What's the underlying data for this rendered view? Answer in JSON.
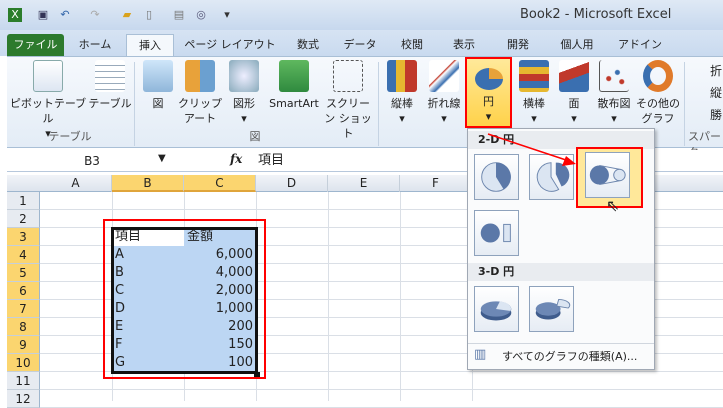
{
  "window": {
    "title": "Book2 - Microsoft Excel"
  },
  "quick_access": [
    "excel-icon",
    "save-icon",
    "undo-icon",
    "redo-icon",
    "open-icon",
    "new-icon",
    "print-preview-icon",
    "zoom-icon",
    "customize-icon"
  ],
  "tabs": [
    "ファイル",
    "ホーム",
    "挿入",
    "ページ レイアウト",
    "数式",
    "データ",
    "校閲",
    "表示",
    "開発",
    "個人用",
    "アドイン"
  ],
  "ribbon": {
    "groups": [
      "テーブル",
      "図",
      "スパーク"
    ],
    "buttons": [
      "ピボットテーブル",
      "テーブル",
      "図",
      "クリップ アート",
      "図形",
      "SmartArt",
      "スクリーン ショット",
      "縦棒",
      "折れ線",
      "円",
      "横棒",
      "面",
      "散布図",
      "その他の グラフ"
    ],
    "sparklines": [
      "折",
      "縦",
      "勝"
    ]
  },
  "formula_bar": {
    "name_box": "B3",
    "fx": "fx",
    "value": "項目"
  },
  "columns": [
    "A",
    "B",
    "C",
    "D",
    "E",
    "F"
  ],
  "rows": [
    "1",
    "2",
    "3",
    "4",
    "5",
    "6",
    "7",
    "8",
    "9",
    "10",
    "11",
    "12"
  ],
  "table": {
    "headers": [
      "項目",
      "金額"
    ],
    "rows": [
      [
        "A",
        "6,000"
      ],
      [
        "B",
        "4,000"
      ],
      [
        "C",
        "2,000"
      ],
      [
        "D",
        "1,000"
      ],
      [
        "E",
        "200"
      ],
      [
        "F",
        "150"
      ],
      [
        "G",
        "100"
      ]
    ]
  },
  "dropdown": {
    "section_2d": "2-D 円",
    "section_3d": "3-D 円",
    "all_charts": "すべてのグラフの種類(A)...",
    "items": [
      "pie",
      "exploded-pie",
      "pie-of-pie",
      "bar-of-pie",
      "3d-pie",
      "3d-exploded-pie"
    ]
  },
  "colors": {
    "highlight": "#ff0000",
    "selection": "#bcd6f3",
    "header_selected": "#fbd56f"
  }
}
